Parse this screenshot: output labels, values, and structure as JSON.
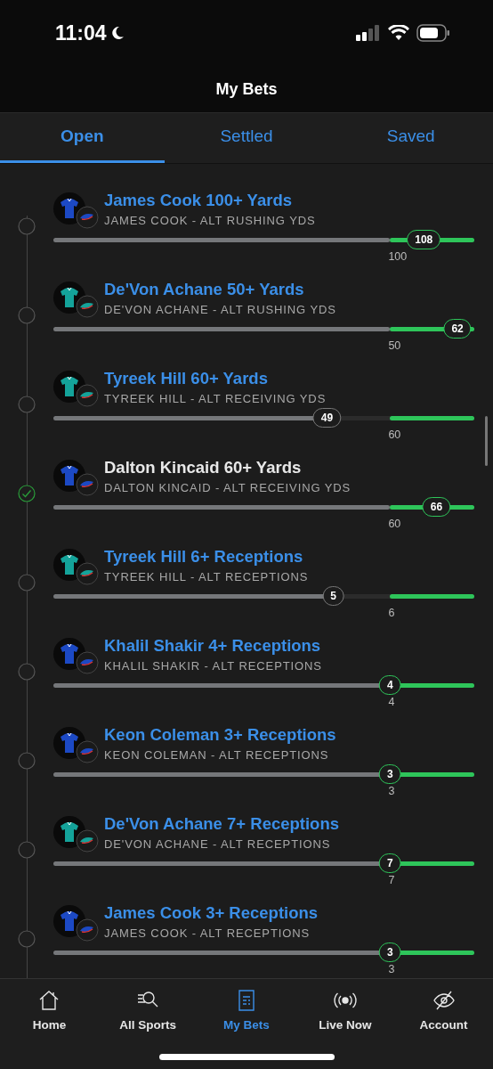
{
  "status_bar": {
    "time": "11:04"
  },
  "header": {
    "title": "My Bets"
  },
  "tabs": [
    {
      "label": "Open",
      "selected": true
    },
    {
      "label": "Settled",
      "selected": false
    },
    {
      "label": "Saved",
      "selected": false
    }
  ],
  "legs": [
    {
      "title": "James Cook 100+ Yards",
      "subtitle": "JAMES COOK - ALT RUSHING YDS",
      "color": "#1c49c4",
      "hit": false,
      "current": "108",
      "line": "100",
      "level": 0.88
    },
    {
      "title": "De'Von Achane 50+ Yards",
      "subtitle": "DE'VON ACHANE - ALT RUSHING YDS",
      "color": "#14a39a",
      "hit": false,
      "current": "62",
      "line": "50",
      "level": 0.98
    },
    {
      "title": "Tyreek Hill 60+ Yards",
      "subtitle": "TYREEK HILL - ALT RECEIVING YDS",
      "color": "#14a39a",
      "hit": false,
      "current": "49",
      "line": "60",
      "level": 0.65
    },
    {
      "title": "Dalton Kincaid 60+ Yards",
      "subtitle": "DALTON KINCAID - ALT RECEIVING YDS",
      "color": "#1c49c4",
      "hit": true,
      "current": "66",
      "line": "60",
      "level": 0.91
    },
    {
      "title": "Tyreek Hill 6+ Receptions",
      "subtitle": "TYREEK HILL - ALT RECEPTIONS",
      "color": "#14a39a",
      "hit": false,
      "current": "5",
      "line": "6",
      "level": 0.665
    },
    {
      "title": "Khalil Shakir 4+ Receptions",
      "subtitle": "KHALIL SHAKIR - ALT RECEPTIONS",
      "color": "#1c49c4",
      "hit": false,
      "current": "4",
      "line": "4",
      "level": 0.8
    },
    {
      "title": "Keon Coleman 3+ Receptions",
      "subtitle": "KEON COLEMAN - ALT RECEPTIONS",
      "color": "#1c49c4",
      "hit": false,
      "current": "3",
      "line": "3",
      "level": 0.8
    },
    {
      "title": "De'Von Achane 7+ Receptions",
      "subtitle": "DE'VON ACHANE - ALT RECEPTIONS",
      "color": "#14a39a",
      "hit": false,
      "current": "7",
      "line": "7",
      "level": 0.8
    },
    {
      "title": "James Cook 3+ Receptions",
      "subtitle": "JAMES COOK - ALT RECEPTIONS",
      "color": "#1c49c4",
      "hit": false,
      "current": "3",
      "line": "3",
      "level": 0.8
    }
  ],
  "nav": [
    {
      "label": "Home",
      "kind": "home",
      "selected": false
    },
    {
      "label": "All Sports",
      "kind": "search",
      "selected": false
    },
    {
      "label": "My Bets",
      "kind": "bets",
      "selected": true
    },
    {
      "label": "Live Now",
      "kind": "live",
      "selected": false
    },
    {
      "label": "Account",
      "kind": "account",
      "selected": false
    }
  ]
}
